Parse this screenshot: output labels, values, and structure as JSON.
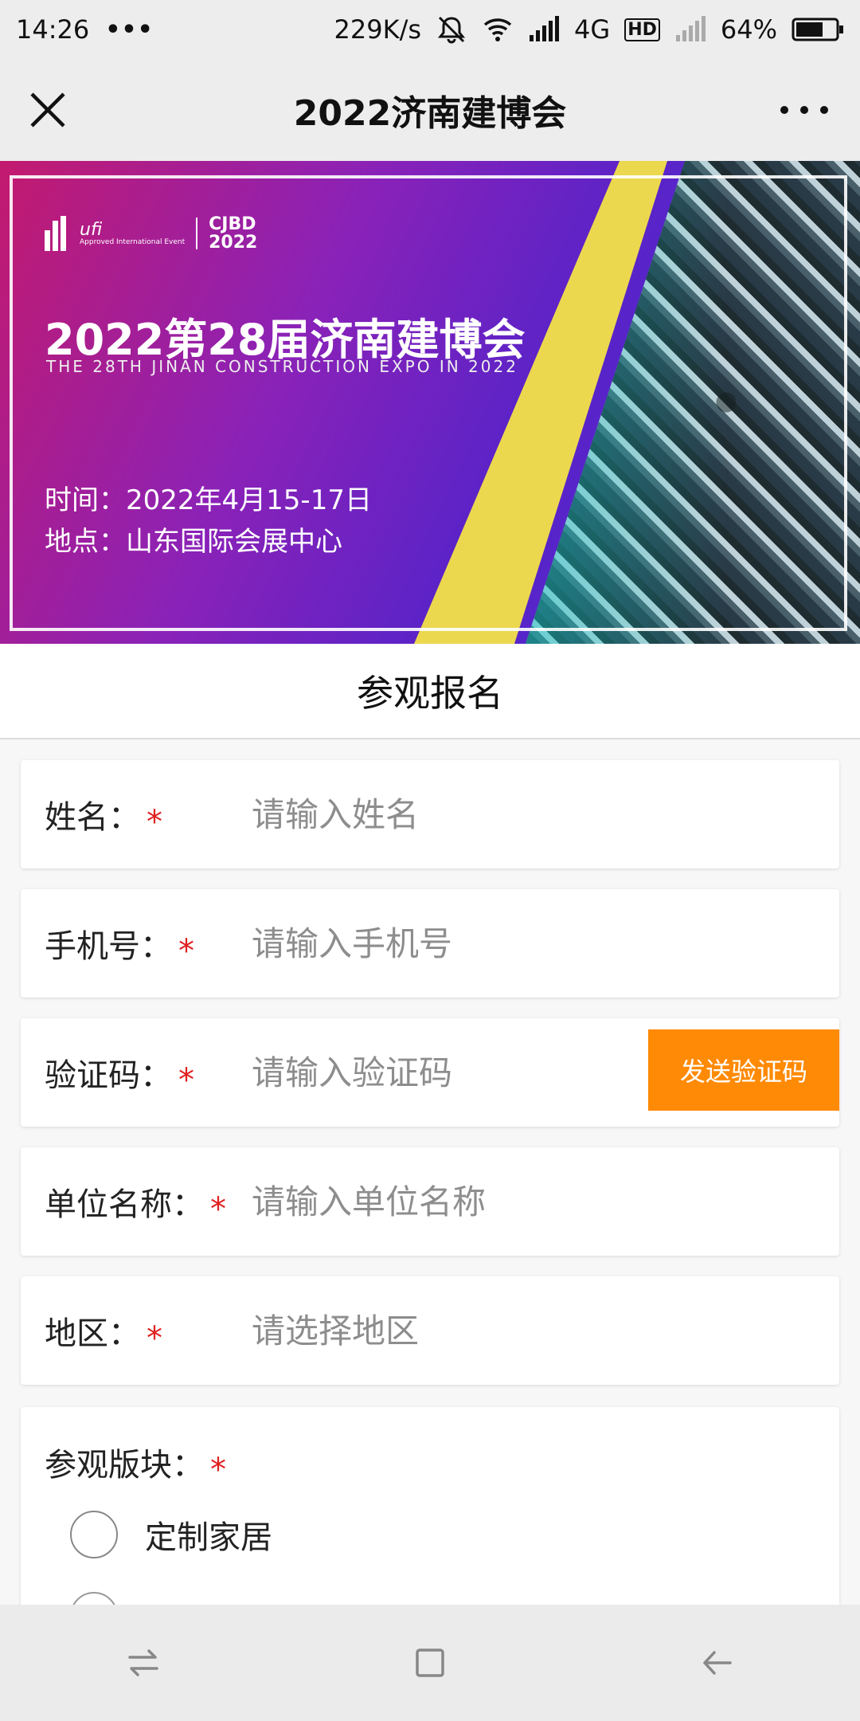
{
  "status_bar": {
    "time": "14:26",
    "dots": "•••",
    "net_speed": "229K/s",
    "network": "4G",
    "hd": "HD",
    "battery": "64%"
  },
  "nav": {
    "title": "2022济南建博会",
    "close_icon": "close-icon",
    "more_icon": "more-icon"
  },
  "banner": {
    "logo_ufi": "ufi",
    "logo_ufi_sub": "Approved International Event",
    "logo_cjbd_1": "CJBD",
    "logo_cjbd_2": "2022",
    "title": "2022第28届济南建博会",
    "subtitle": "THE 28TH JINAN CONSTRUCTION EXPO IN 2022",
    "time_line": "时间：2022年4月15-17日",
    "place_line": "地点：山东国际会展中心"
  },
  "section_title": "参观报名",
  "form": {
    "name": {
      "label": "姓名：",
      "required": "*",
      "placeholder": "请输入姓名"
    },
    "phone": {
      "label": "手机号：",
      "required": "*",
      "placeholder": "请输入手机号"
    },
    "code": {
      "label": "验证码：",
      "required": "*",
      "placeholder": "请输入验证码",
      "button": "发送验证码"
    },
    "company": {
      "label": "单位名称：",
      "required": "*",
      "placeholder": "请输入单位名称"
    },
    "region": {
      "label": "地区：",
      "required": "*",
      "placeholder": "请选择地区"
    },
    "visit_section": {
      "label": "参观版块：",
      "required": "*",
      "options": [
        "定制家居"
      ]
    }
  },
  "colors": {
    "accent_orange": "#ff8a05",
    "required_red": "#e02020",
    "banner_yellow": "#ecd84e",
    "banner_purple": "#5a23c8"
  },
  "bottom_nav": {
    "icons": [
      "switch-apps-icon",
      "home-square-icon",
      "back-arrow-icon"
    ]
  }
}
